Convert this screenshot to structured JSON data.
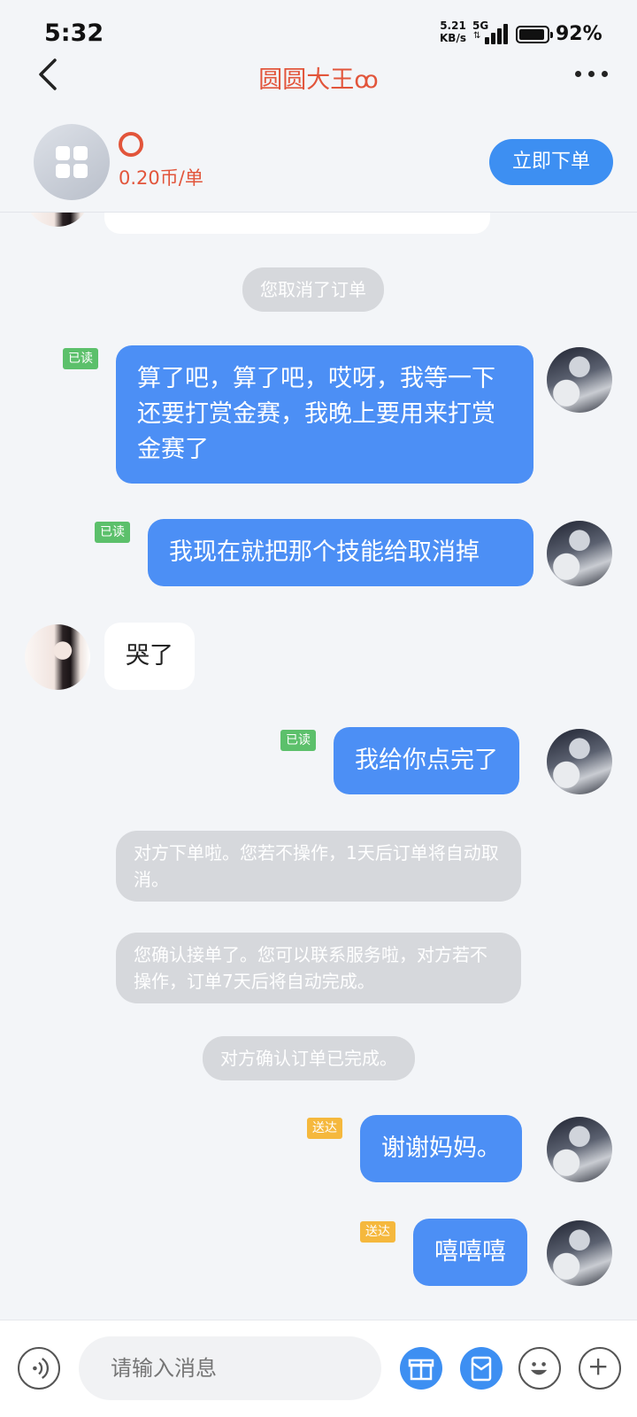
{
  "status_bar": {
    "time": "5:32",
    "net_speed": "5.21",
    "net_unit": "KB/s",
    "signal_type": "5G",
    "battery_percent": "92%"
  },
  "nav": {
    "title": "圆圆大王ꝏ",
    "back_icon": "chevron-left-icon",
    "more_icon": "more-dots-icon"
  },
  "service": {
    "price": "0.20币/单",
    "order_button": "立即下单"
  },
  "messages": {
    "system_cancel": "您取消了订单",
    "m1": "算了吧，算了吧，哎呀，我等一下还要打赏金赛，我晚上要用来打赏金赛了",
    "m1_status": "已读",
    "m2": "我现在就把那个技能给取消掉",
    "m2_status": "已读",
    "m3": "哭了",
    "m4": "我给你点完了",
    "m4_status": "已读",
    "system_order": "对方下单啦。您若不操作，1天后订单将自动取消。",
    "system_accept": "您确认接单了。您可以联系服务啦，对方若不操作，订单7天后将自动完成。",
    "system_complete": "对方确认订单已完成。",
    "m5": "谢谢妈妈。",
    "m5_status": "送达",
    "m6": "嘻嘻嘻",
    "m6_status": "送达"
  },
  "input": {
    "placeholder": "请输入消息"
  },
  "colors": {
    "accent": "#3d8ff2",
    "bubble_out": "#4c8ff5",
    "title_red": "#e2553b",
    "read_green": "#5cc06b",
    "sent_yellow": "#f5b83d"
  }
}
